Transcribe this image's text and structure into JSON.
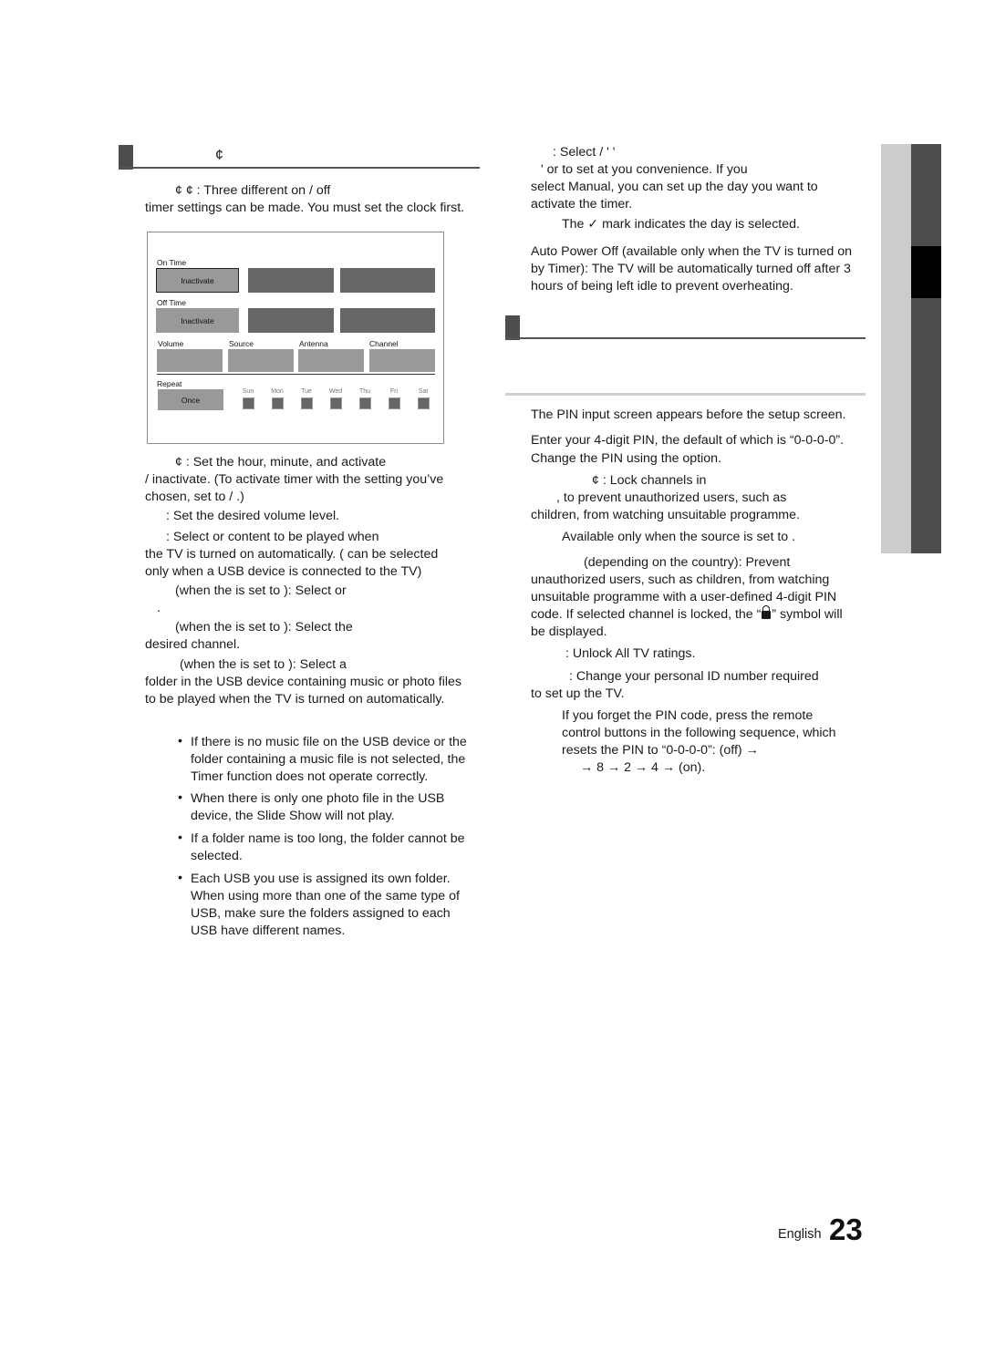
{
  "left_section": {
    "heading_glyph": "¢",
    "intro_line1": "¢          ¢          : Three different on / off",
    "intro_line2": "timer settings can be made. You must set the clock first.",
    "osd": {
      "on_time_label": "On Time",
      "on_time_value": "Inactivate",
      "off_time_label": "Off Time",
      "off_time_value": "Inactivate",
      "volume_label": "Volume",
      "source_label": "Source",
      "antenna_label": "Antenna",
      "channel_label": "Channel",
      "repeat_label": "Repeat",
      "repeat_value": "Once",
      "days": [
        "Sun",
        "Mon",
        "Tue",
        "Wed",
        "Thu",
        "Fri",
        "Sat"
      ]
    },
    "para": [
      "¢          : Set the hour, minute, and activate",
      "/ inactivate. (To activate timer with the setting you’ve",
      "chosen, set to    /   .)",
      ": Set the desired volume level.",
      ": Select    or     content to be played when",
      "the TV is turned on automatically. (    can be selected",
      "only when a USB device is connected to the TV)",
      "(when the          is set to    ): Select     or",
      ".",
      "(when the          is set to    ): Select the",
      "desired channel.",
      "(when the          is set to    ): Select a",
      "folder in the USB device containing music or photo files",
      "to be played when the TV is turned on automatically."
    ],
    "notes": [
      [
        "If there is no music file on the USB device or the",
        "folder containing a music file is not selected, the",
        "Timer function does not operate correctly."
      ],
      [
        "When there is only one photo file in the USB",
        "device, the Slide Show will not play."
      ],
      [
        "If a folder name is too long, the folder cannot be",
        "selected."
      ],
      [
        "Each USB you use is assigned its own folder.",
        "When using more than one of the same type of",
        "USB, make sure the folders assigned to each",
        "USB have different names."
      ]
    ],
    "bullet_glyph": "•"
  },
  "right_section": {
    "repeat_para": [
      ": Select       /           '        '",
      "'    or          to set at you convenience. If you",
      "select Manual, you can set up the day you want to",
      "activate the timer."
    ],
    "check_note_pre": "The",
    "check_glyph": "✓",
    "check_note_post": "mark indicates the day is selected.",
    "auto_power_off": [
      "Auto Power Off (available only when the TV is turned on",
      "by Timer): The TV will be automatically turned off after 3",
      "hours of being left idle to prevent overheating."
    ],
    "pin_note": "The PIN input screen appears before the setup screen.",
    "pin_para": [
      "Enter your 4-digit PIN, the default of which is “0-0-0-0”.",
      "Change the PIN using the             option."
    ],
    "lock_para": [
      "¢    : Lock channels in",
      ", to prevent unauthorized users, such as",
      "children, from watching unsuitable programme."
    ],
    "available_note": "Available only when the        source is set to         .",
    "rating_para_1": "(depending on the country): Prevent",
    "rating_para": [
      "unauthorized users, such as children, from watching",
      "unsuitable programme with a user-defined 4-digit PIN"
    ],
    "rating_code_pre": "code. If selected channel is locked, the “",
    "rating_code_post": "” symbol will",
    "rating_last": "be displayed.",
    "unlock_line": ": Unlock All TV ratings.",
    "change_pin": [
      ": Change your personal ID number required",
      "to set up the TV."
    ],
    "forget_pin": [
      "If you forget the PIN code, press the remote",
      "control buttons in the following sequence, which",
      "resets the PIN to “0-0-0-0”:        (off) →",
      "→ 8 → 2 → 4 →         (on)."
    ]
  },
  "footer": {
    "language": "English",
    "page_number": "23"
  },
  "colors": {
    "marker": "#4d4d4d",
    "sidebar_light": "#cccccc",
    "sidebar_dark": "#4d4d4d",
    "sidebar_active": "#000000",
    "osd_box": "#999999",
    "osd_dark": "#666666"
  }
}
